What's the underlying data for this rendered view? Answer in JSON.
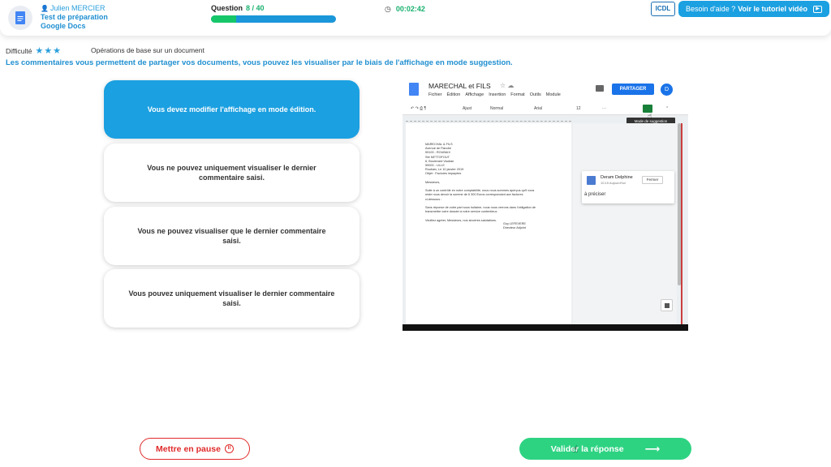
{
  "header": {
    "user_name": "Julien MERCIER",
    "test_title_line1": "Test de préparation",
    "test_title_line2": "Google Docs",
    "question_label": "Question",
    "question_count": "8 / 40",
    "progress": 0.2,
    "timer": "00:02:42",
    "logo_text": "ICDL",
    "help_prefix": "Besoin d'aide ?",
    "help_link": "Voir le tutoriel vidéo"
  },
  "question": {
    "difficulty_label": "Difficulté",
    "stars": "★★★",
    "category": "Opérations de base sur un document",
    "prompt": "Les commentaires vous permettent de partager vos documents, vous pouvez les visualiser par le biais de l'affichage en mode suggestion."
  },
  "answers": [
    {
      "text": "Vous devez modifier l'affichage en mode édition.",
      "selected": true
    },
    {
      "text": "Vous ne pouvez uniquement visualiser le dernier commentaire saisi.",
      "selected": false
    },
    {
      "text": "Vous ne pouvez visualiser que le dernier commentaire saisi.",
      "selected": false
    },
    {
      "text": "Vous pouvez uniquement visualiser le dernier commentaire saisi.",
      "selected": false
    }
  ],
  "screenshot": {
    "doc_title": "MARECHAL et FILS",
    "menu": [
      "Fichier",
      "Édition",
      "Affichage",
      "Insertion",
      "Format",
      "Outils",
      "Module"
    ],
    "share_label": "PARTAGER",
    "avatar_letter": "D",
    "toolbar": {
      "zoom": "Ajust",
      "style": "Normal",
      "font": "Arial",
      "size": "12",
      "more": "···"
    },
    "tooltip": "Mode de suggestion",
    "letter_text": "MARECHAL & FILS\nAvenue de Flandre\n59100 - ROUBAIX\nSté NETTOFOUT\n6, Boulevard Vauban\n59000 - LILLE\nRoubaix, Le 10 janvier 2019\nObjet : Factures impayées\n\nMessieurs,\n\nSuite à un contrôle en notre comptabilité, nous nous sommes aperçus qu'il vous\nreste nous devoir la somme de 6 300 Euros correspondant aux factures\nci-dessous :\n\nSans réponse de votre part sous huitaine, nous nous verrons dans l'obligation de\ntransmettre votre dossier à notre service contentieux.\n\nVeuillez agréer, Messieurs, nos sincères salutations.",
    "signature": "Guy LEFEVERE\nDirecteur Adjoint",
    "comment": {
      "author": "Deram Delphine",
      "time": "10:15 Aujourd'hui",
      "close_label": "Fermer",
      "text": "à préciser"
    }
  },
  "footer": {
    "pause_label": "Mettre en pause",
    "validate_label": "Valider la réponse"
  }
}
